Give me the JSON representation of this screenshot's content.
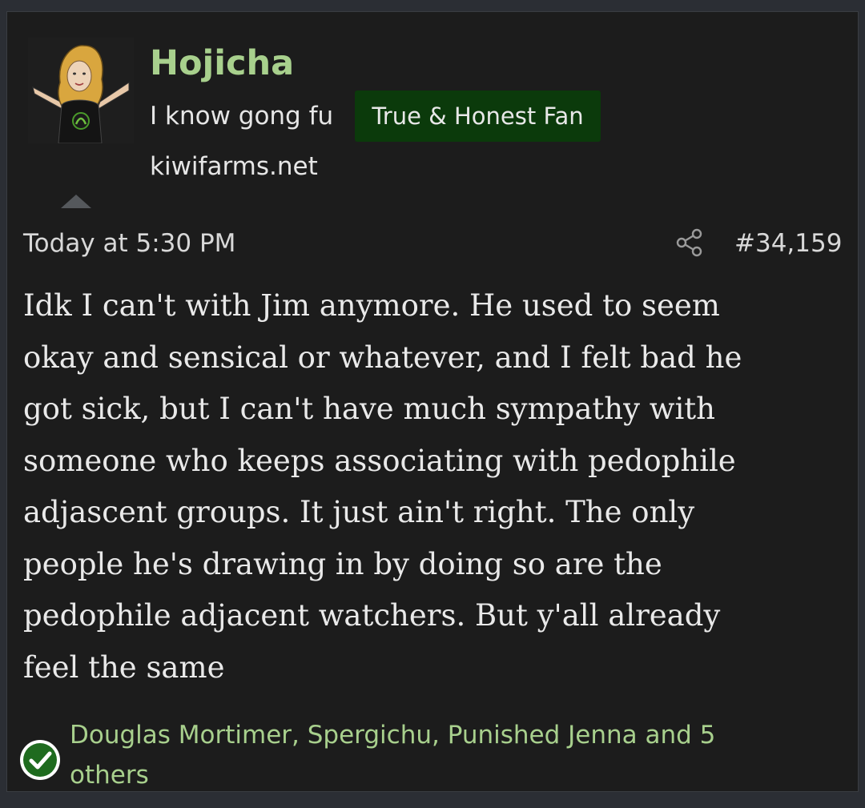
{
  "post": {
    "author": {
      "name": "Hojicha",
      "title": "I know gong fu",
      "badge": "True & Honest Fan",
      "site": "kiwifarms.net",
      "avatar_icon": "avatar-woman-arms-raised"
    },
    "timestamp": "Today at 5:30 PM",
    "share_icon": "share-icon",
    "post_number": "#34,159",
    "body_lines": [
      "Idk I can't with Jim anymore. He used to seem",
      "okay and sensical or whatever, and I felt bad he",
      "got sick, but I can't have much sympathy with",
      "someone who keeps associating with pedophile",
      "adjascent groups. It just ain't right. The only",
      "people he's drawing in by doing so are the",
      "pedophile adjacent watchers. But y'all already",
      "feel the same"
    ],
    "reactions": {
      "icon": "check-circle-icon",
      "lines": [
        "Douglas Mortimer, Spergichu, Punished Jenna and 5",
        "others"
      ]
    }
  },
  "colors": {
    "background": "#1c1c1c",
    "username": "#a8d08d",
    "badge_bg": "#0b3a0b",
    "text": "#e9e9e9",
    "reaction_green": "#1f6b1f"
  }
}
